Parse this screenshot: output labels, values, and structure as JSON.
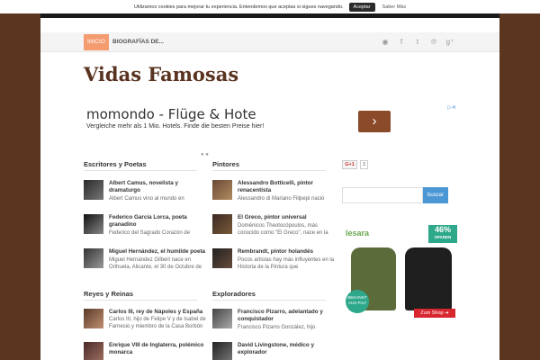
{
  "cookie": {
    "message": "Utilizamos cookies para mejorar tu experiencia. Entendemos que aceptas si sigues navegando.",
    "accept": "Aceptar",
    "more": "Saber Más"
  },
  "nav": {
    "home": "INICIO",
    "bios": "BIOGRAFÍAS DE...",
    "social": [
      "rss-icon",
      "facebook-icon",
      "twitter-icon",
      "pinterest-icon",
      "google-plus-icon"
    ],
    "social_glyphs": [
      "◉",
      "f",
      "t",
      "℗",
      "g⁺"
    ]
  },
  "site_title": "Vidas Famosas",
  "ad": {
    "headline": "momondo - Flüge & Hote",
    "description": "Vergleiche mehr als 1 Mio. Hotels. Finde die besten Preise hier!",
    "arrow": "›",
    "adchoices": "▷✕"
  },
  "carousel_dots": "● ●",
  "sections": {
    "writers": {
      "title": "Escritores y Poetas",
      "posts": [
        {
          "title": "Albert Camus, novelista y dramaturgo",
          "excerpt": "Albert Camus vino al mundo en"
        },
        {
          "title": "Federico García Lorca, poeta granadino",
          "excerpt": "Federico del Sagrado Corazón de"
        },
        {
          "title": "Miguel Hernández, el humilde poeta",
          "excerpt": "Miguel Hernández Gilbert nace en Orihuela, Alicante, el 30 de Octubre de"
        }
      ]
    },
    "painters": {
      "title": "Pintores",
      "posts": [
        {
          "title": "Alessandro Botticelli, pintor renacentista",
          "excerpt": "Alessandro di Mariano Filipepi nació"
        },
        {
          "title": "El Greco, pintor universal",
          "excerpt": "Doménicos Theotocópoulos, más conocido como \"El Greco\", nace en la"
        },
        {
          "title": "Rembrandt, pintor holandés",
          "excerpt": "Pocos artistas hay más influyentes en la Historia de la Pintura que"
        }
      ]
    },
    "kings": {
      "title": "Reyes y Reinas",
      "posts": [
        {
          "title": "Carlos III, rey de Nápoles y España",
          "excerpt": "Carlos III, hijo de Felipe V y de Isabel de Farnesio y miembro de la Casa Borbón"
        },
        {
          "title": "Enrique VIII de Inglaterra, polémico monarca",
          "excerpt": ""
        }
      ]
    },
    "explorers": {
      "title": "Exploradores",
      "posts": [
        {
          "title": "Francisco Pizarro, adelantado y conquistador",
          "excerpt": "Francisco Pizarro González, hijo"
        },
        {
          "title": "David Livingstone, médico y explorador",
          "excerpt": ""
        }
      ]
    }
  },
  "sidebar": {
    "gplus_label": "G+1",
    "gplus_count": "3",
    "search_placeholder": "",
    "search_button": "buscar"
  },
  "banner": {
    "brand": "lesara",
    "discount": "46%",
    "discount_label": "SPAREN",
    "badge_text": "BEKANNT AUS Pro7",
    "shop": "Zum Shop ➔"
  }
}
